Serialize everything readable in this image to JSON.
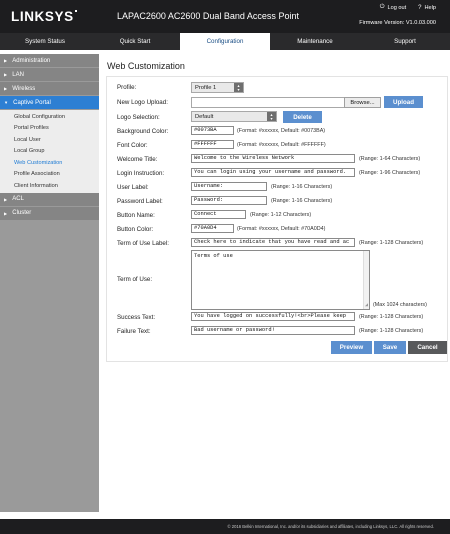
{
  "header": {
    "brand": "LINKSYS",
    "product": "LAPAC2600 AC2600 Dual Band Access Point",
    "logout_label": "Log out",
    "help_label": "Help",
    "firmware": "Firmware Version: V1.0.03.000"
  },
  "nav": {
    "tabs": [
      "System Status",
      "Quick Start",
      "Configuration",
      "Maintenance",
      "Support"
    ],
    "active": "Configuration"
  },
  "sidebar": {
    "groups": [
      "Administration",
      "LAN",
      "Wireless",
      "Captive Portal",
      "ACL",
      "Cluster"
    ],
    "captive_items": [
      "Global Configuration",
      "Portal Profiles",
      "Local User",
      "Local Group",
      "Web Customization",
      "Profile Association",
      "Client Information"
    ]
  },
  "page": {
    "title": "Web Customization"
  },
  "form": {
    "profile_label": "Profile:",
    "profile_value": "Profile 1",
    "new_logo_label": "New Logo Upload:",
    "browse_label": "Browse...",
    "upload_label": "Upload",
    "logo_selection_label": "Logo Selection:",
    "logo_selection_value": "Default",
    "delete_label": "Delete",
    "bg_color_label": "Background Color:",
    "bg_color_value": "#0073BA",
    "bg_color_hint": "(Format: #xxxxxx, Default: #0073BA)",
    "font_color_label": "Font Color:",
    "font_color_value": "#FFFFFF",
    "font_color_hint": "(Format: #xxxxxx, Default: #FFFFFF)",
    "welcome_label": "Welcome Title:",
    "welcome_value": "Welcome to the Wireless Network",
    "welcome_hint": "(Range: 1-64 Characters)",
    "login_instr_label": "Login Instruction:",
    "login_instr_value": "You can login using your username and password.",
    "login_instr_hint": "(Range: 1-96 Characters)",
    "user_label_label": "User Label:",
    "user_label_value": "Username:",
    "user_label_hint": "(Range: 1-16 Characters)",
    "password_label_label": "Password Label:",
    "password_label_value": "Password:",
    "password_label_hint": "(Range: 1-16 Characters)",
    "button_name_label": "Button Name:",
    "button_name_value": "Connect",
    "button_name_hint": "(Range: 1-12 Characters)",
    "button_color_label": "Button Color:",
    "button_color_value": "#70A0D4",
    "button_color_hint": "(Format: #xxxxxx, Default: #70A0D4)",
    "terms_label_label": "Term of Use Label:",
    "terms_label_value": "Check here to indicate that you have read and ac",
    "terms_label_hint": "(Range: 1-128 Characters)",
    "terms_of_use_label": "Term of Use:",
    "terms_of_use_value": "Terms of use",
    "terms_of_use_hint": "(Max 1024 characters)",
    "success_label": "Success Text:",
    "success_value": "You have logged on successfully!<br>Please keep",
    "success_hint": "(Range: 1-128 Characters)",
    "failure_label": "Failure Text:",
    "failure_value": "Bad username or password!",
    "failure_hint": "(Range: 1-128 Characters)",
    "preview_label": "Preview",
    "save_label": "Save",
    "cancel_label": "Cancel"
  },
  "footer": {
    "copyright": "© 2016 Belkin International, Inc. and/or its subsidiaries and affiliates, including Linksys, LLC. All rights reserved."
  },
  "colors": {
    "header_bg": "#1d1d1f",
    "accent_blue": "#2d7fd3",
    "button_blue": "#5b8fcf",
    "button_dark": "#58595b"
  }
}
